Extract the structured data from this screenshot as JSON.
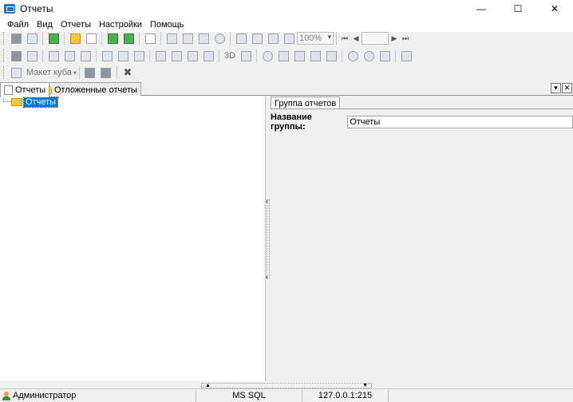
{
  "window": {
    "title": "Отчеты",
    "min_glyph": "—",
    "max_glyph": "☐",
    "close_glyph": "✕"
  },
  "menu": [
    "Файл",
    "Вид",
    "Отчеты",
    "Настройки",
    "Помощь"
  ],
  "toolbar": {
    "zoom": "100%",
    "three_d": "3D",
    "cube_layout": "Макет куба"
  },
  "tabs": [
    {
      "label": "Отчеты"
    },
    {
      "label": "Отложенные отчеты"
    }
  ],
  "tab_controls": {
    "dropdown": "▾",
    "close": "✕"
  },
  "tree": {
    "root_label": "Отчеты"
  },
  "right": {
    "tab_label": "Группа отчетов",
    "field_label": "Название группы:",
    "field_value": "Отчеты"
  },
  "status": {
    "user": "Администратор",
    "db": "MS SQL",
    "server": "127.0.0.1:215"
  }
}
